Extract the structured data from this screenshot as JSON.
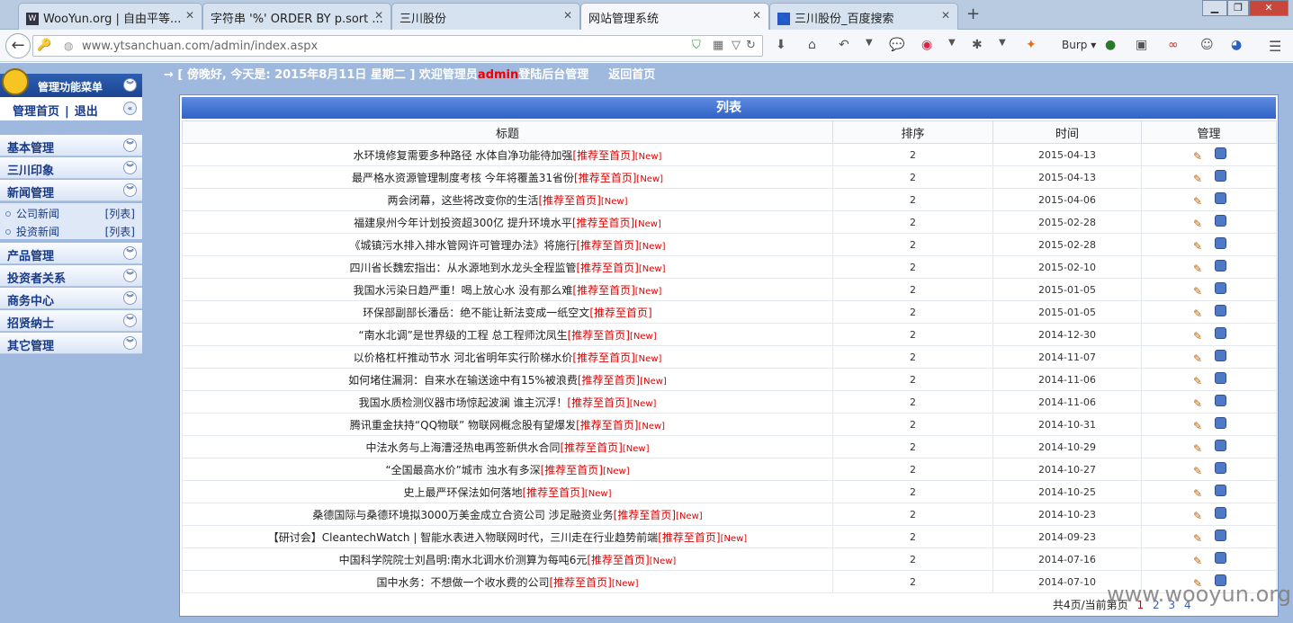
{
  "browser": {
    "tabs": [
      {
        "label": "WooYun.org | 自由平等..."
      },
      {
        "label": "字符串 '%' ORDER BY p.sort ..."
      },
      {
        "label": "三川股份"
      },
      {
        "label": "网站管理系统"
      },
      {
        "label": "三川股份_百度搜索"
      }
    ],
    "url": "www.ytsanchuan.com/admin/index.aspx",
    "burp_label": "Burp"
  },
  "header": {
    "greeting": "→ [ 傍晚好, 今天是: 2015年8月11日 星期二 ] 欢迎管理员",
    "admin": "admin",
    "login_text": "登陆后台管理",
    "back_home": "返回首页"
  },
  "sidebar": {
    "title": "管理功能菜单",
    "home": "管理首页",
    "sep": "|",
    "logout": "退出",
    "sections": [
      {
        "label": "基本管理"
      },
      {
        "label": "三川印象"
      },
      {
        "label": "新闻管理"
      },
      {
        "label": "产品管理"
      },
      {
        "label": "投资者关系"
      },
      {
        "label": "商务中心"
      },
      {
        "label": "招贤纳士"
      },
      {
        "label": "其它管理"
      }
    ],
    "sub_items": [
      {
        "label": "公司新闻",
        "action": "[列表]"
      },
      {
        "label": "投资新闻",
        "action": "[列表]"
      }
    ]
  },
  "list": {
    "heading": "列表",
    "columns": [
      "标题",
      "排序",
      "时间",
      "管理"
    ],
    "rec_label": "[推荐至首页]",
    "new_label": "[New]",
    "rows": [
      {
        "title": "水环境修复需要多种路径 水体自净功能待加强",
        "new": true,
        "sort": "2",
        "date": "2015-04-13"
      },
      {
        "title": "最严格水资源管理制度考核 今年将覆盖31省份",
        "new": true,
        "sort": "2",
        "date": "2015-04-13"
      },
      {
        "title": "两会闭幕，这些将改变你的生活",
        "new": true,
        "sort": "2",
        "date": "2015-04-06"
      },
      {
        "title": "福建泉州今年计划投资超300亿 提升环境水平",
        "new": true,
        "sort": "2",
        "date": "2015-02-28"
      },
      {
        "title": "《城镇污水排入排水管网许可管理办法》将施行",
        "new": true,
        "sort": "2",
        "date": "2015-02-28"
      },
      {
        "title": "四川省长魏宏指出：从水源地到水龙头全程监管",
        "new": true,
        "sort": "2",
        "date": "2015-02-10"
      },
      {
        "title": "我国水污染日趋严重！喝上放心水 没有那么难",
        "new": true,
        "sort": "2",
        "date": "2015-01-05"
      },
      {
        "title": "环保部副部长潘岳：绝不能让新法变成一纸空文",
        "new": false,
        "sort": "2",
        "date": "2015-01-05"
      },
      {
        "title": "“南水北调”是世界级的工程 总工程师沈凤生",
        "new": true,
        "sort": "2",
        "date": "2014-12-30"
      },
      {
        "title": "以价格杠杆推动节水 河北省明年实行阶梯水价",
        "new": true,
        "sort": "2",
        "date": "2014-11-07"
      },
      {
        "title": "如何堵住漏洞：自来水在输送途中有15%被浪费",
        "new": true,
        "sort": "2",
        "date": "2014-11-06"
      },
      {
        "title": "我国水质检测仪器市场惊起波澜 谁主沉浮！",
        "new": true,
        "sort": "2",
        "date": "2014-11-06"
      },
      {
        "title": "腾讯重金扶持“QQ物联” 物联网概念股有望爆发",
        "new": true,
        "sort": "2",
        "date": "2014-10-31"
      },
      {
        "title": "中法水务与上海漕泾热电再签新供水合同",
        "new": true,
        "sort": "2",
        "date": "2014-10-29"
      },
      {
        "title": "“全国最高水价”城市 浊水有多深",
        "new": true,
        "sort": "2",
        "date": "2014-10-27"
      },
      {
        "title": "史上最严环保法如何落地",
        "new": true,
        "sort": "2",
        "date": "2014-10-25"
      },
      {
        "title": "桑德国际与桑德环境拟3000万美金成立合资公司 涉足融资业务",
        "new": true,
        "sort": "2",
        "date": "2014-10-23"
      },
      {
        "title": "【研讨会】CleantechWatch | 智能水表进入物联网时代，三川走在行业趋势前端",
        "new": true,
        "sort": "2",
        "date": "2014-09-23"
      },
      {
        "title": "中国科学院院士刘昌明:南水北调水价测算为每吨6元",
        "new": true,
        "sort": "2",
        "date": "2014-07-16"
      },
      {
        "title": "国中水务：不想做一个收水费的公司",
        "new": true,
        "sort": "2",
        "date": "2014-07-10"
      }
    ]
  },
  "pager": {
    "text": "共4页/当前第",
    "suffix": "页",
    "pages": [
      "1",
      "2",
      "3",
      "4"
    ]
  },
  "watermark": "www.wooyun.org"
}
